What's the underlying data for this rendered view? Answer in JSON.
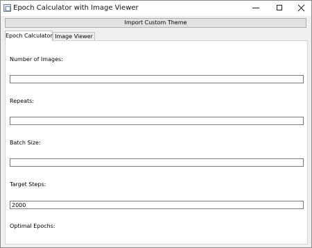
{
  "window": {
    "title": "Epoch Calculator with Image Viewer"
  },
  "toolbar": {
    "import_label": "Import Custom Theme"
  },
  "tabs": [
    {
      "label": "Epoch Calculator",
      "active": true
    },
    {
      "label": "Image Viewer",
      "active": false
    }
  ],
  "form": {
    "num_images": {
      "label": "Number of Images:",
      "value": ""
    },
    "repeats": {
      "label": "Repeats:",
      "value": ""
    },
    "batch_size": {
      "label": "Batch Size:",
      "value": ""
    },
    "target_steps": {
      "label": "Target Steps:",
      "value": "2000"
    },
    "optimal_epochs": {
      "label": "Optimal Epochs:"
    }
  }
}
